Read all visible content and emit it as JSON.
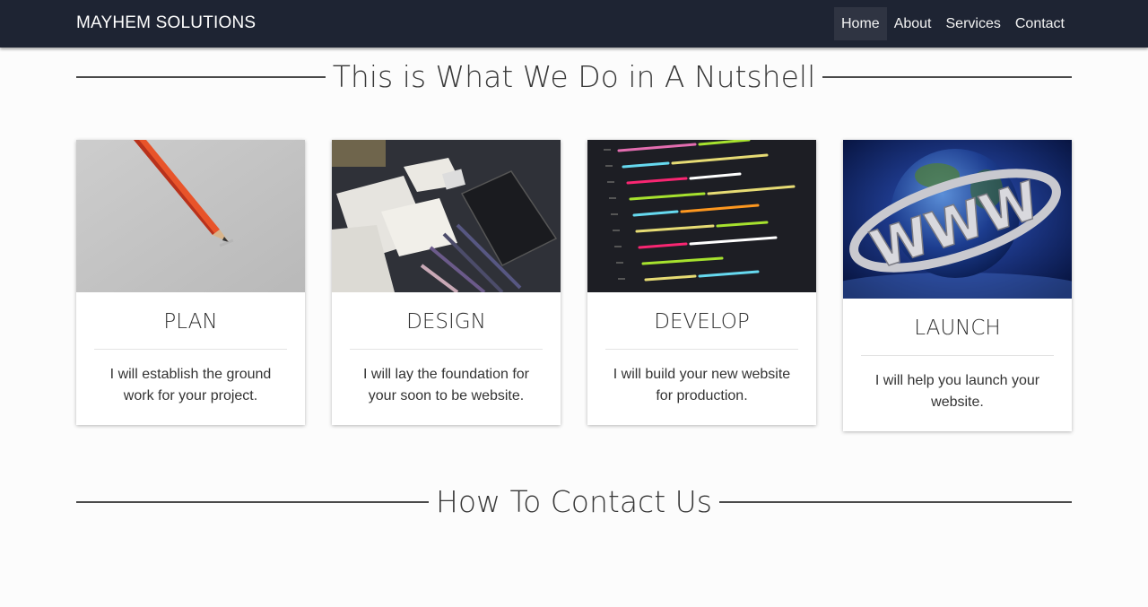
{
  "brand": "MAYHEM SOLUTIONS",
  "nav": [
    {
      "label": "Home",
      "active": true
    },
    {
      "label": "About",
      "active": false
    },
    {
      "label": "Services",
      "active": false
    },
    {
      "label": "Contact",
      "active": false
    }
  ],
  "sections": {
    "what_we_do": "This is What We Do in A Nutshell",
    "contact": "How To Contact Us"
  },
  "cards": [
    {
      "title": "PLAN",
      "text": "I will establish the ground work for your project.",
      "image": "pencil-photo"
    },
    {
      "title": "DESIGN",
      "text": "I will lay the foundation for your soon to be website.",
      "image": "design-desk-photo"
    },
    {
      "title": "DEVELOP",
      "text": "I will build your new website for production.",
      "image": "code-screen-photo"
    },
    {
      "title": "LAUNCH",
      "text": "I will help you launch your website.",
      "image": "www-globe-photo"
    }
  ],
  "colors": {
    "navbar": "#1e2433",
    "background": "#fcfcfc"
  }
}
